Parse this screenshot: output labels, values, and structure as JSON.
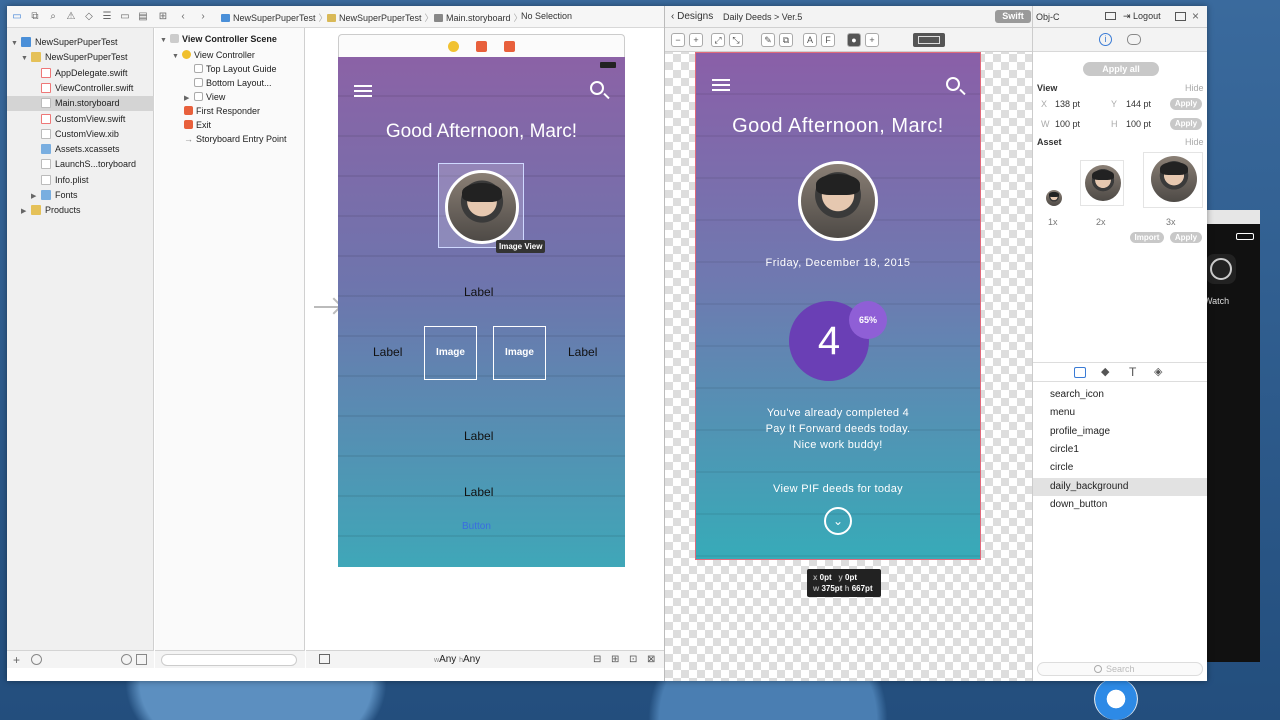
{
  "xcode": {
    "breadcrumb": [
      "NewSuperPuperTest",
      "NewSuperPuperTest",
      "Main.storyboard",
      "No Selection"
    ],
    "navigator": [
      {
        "label": "NewSuperPuperTest",
        "icon": "project",
        "indent": 0,
        "open": true
      },
      {
        "label": "NewSuperPuperTest",
        "icon": "folder",
        "indent": 1,
        "open": true
      },
      {
        "label": "AppDelegate.swift",
        "icon": "swift",
        "indent": 2
      },
      {
        "label": "ViewController.swift",
        "icon": "swift",
        "indent": 2
      },
      {
        "label": "Main.storyboard",
        "icon": "file",
        "indent": 2,
        "selected": true
      },
      {
        "label": "CustomView.swift",
        "icon": "swift",
        "indent": 2
      },
      {
        "label": "CustomView.xib",
        "icon": "file",
        "indent": 2
      },
      {
        "label": "Assets.xcassets",
        "icon": "blue-folder",
        "indent": 2
      },
      {
        "label": "LaunchS...toryboard",
        "icon": "file",
        "indent": 2
      },
      {
        "label": "Info.plist",
        "icon": "file",
        "indent": 2
      },
      {
        "label": "Fonts",
        "icon": "blue-folder",
        "indent": 2,
        "closed": true
      },
      {
        "label": "Products",
        "icon": "folder",
        "indent": 1,
        "closed": true
      }
    ],
    "outline": {
      "scene": "View Controller Scene",
      "controller": "View Controller",
      "items": [
        "Top Layout Guide",
        "Bottom Layout...",
        "View"
      ],
      "first_responder": "First Responder",
      "exit": "Exit",
      "entry": "Storyboard Entry Point"
    },
    "canvas": {
      "title": "Good Afternoon, Marc!",
      "image_view_tag": "Image View",
      "label": "Label",
      "image": "Image",
      "button": "Button",
      "size_w": "Any",
      "size_h": "Any",
      "size_w_prefix": "w",
      "size_h_prefix": "h"
    }
  },
  "designs": {
    "back_label": "Designs",
    "path": "Daily Deeds > Ver.5",
    "lang_active": "Swift",
    "lang_other": "Obj-C",
    "logout": "Logout",
    "tool_letters": [
      "A",
      "F"
    ],
    "mock": {
      "title": "Good Afternoon, Marc!",
      "date": "Friday, December 18, 2015",
      "count": "4",
      "percent": "65%",
      "message": [
        "You've already completed 4",
        "Pay It Forward deeds today.",
        "Nice work buddy!"
      ],
      "link": "View PIF deeds for today"
    },
    "measure": {
      "x": "0pt",
      "y": "0pt",
      "w": "375pt",
      "h": "667pt"
    }
  },
  "inspector": {
    "apply_all": "Apply all",
    "view_title": "View",
    "hide": "Hide",
    "x_label": "X",
    "x_value": "138 pt",
    "y_label": "Y",
    "y_value": "144 pt",
    "w_label": "W",
    "w_value": "100 pt",
    "h_label": "H",
    "h_value": "100 pt",
    "apply": "Apply",
    "asset_title": "Asset",
    "scales": [
      "1x",
      "2x",
      "3x"
    ],
    "import": "Import",
    "layers": [
      "search_icon",
      "menu",
      "profile_image",
      "circle1",
      "circle",
      "daily_background",
      "down_button"
    ],
    "selected_layer": "daily_background",
    "search_placeholder": "Search"
  },
  "watch_label": "Watch",
  "colors": {
    "accent": "#6a3fb5",
    "purple_badge": "#8f5fd6",
    "selection": "#e06a7b"
  }
}
